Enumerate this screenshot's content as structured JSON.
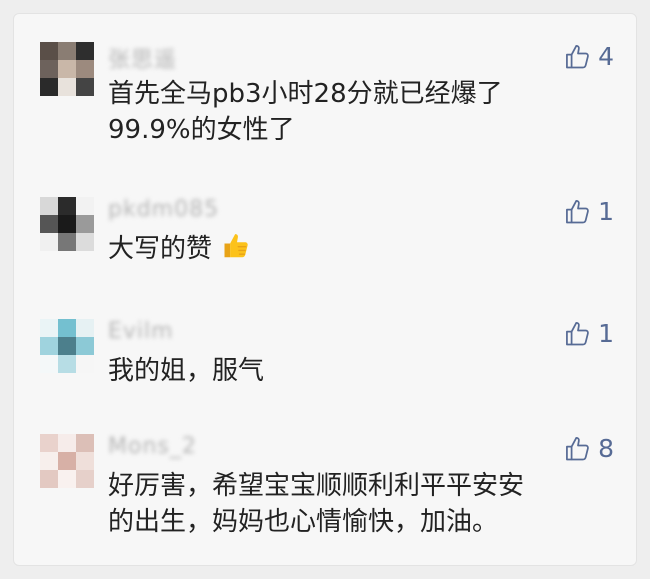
{
  "comments": [
    {
      "username": "张思遥",
      "likes": "4",
      "lines": [
        "首先全马pb3小时28分就已经爆了",
        "99.9%的女性了"
      ]
    },
    {
      "username": "pkdm085",
      "likes": "1",
      "lines": [
        "大写的赞"
      ],
      "emoji": "thumbs-up-emoji"
    },
    {
      "username": "Evilm",
      "likes": "1",
      "lines": [
        "我的姐，服气"
      ]
    },
    {
      "username": "Mons_2",
      "likes": "8",
      "lines": [
        "好厉害，希望宝宝顺顺利利平平安安",
        "的出生，妈妈也心情愉快，加油。"
      ]
    }
  ],
  "icons": {
    "like": "thumbs-up-outline-icon"
  },
  "colors": {
    "like": "#576b95",
    "text": "#222222",
    "username": "#b5b5b5"
  }
}
